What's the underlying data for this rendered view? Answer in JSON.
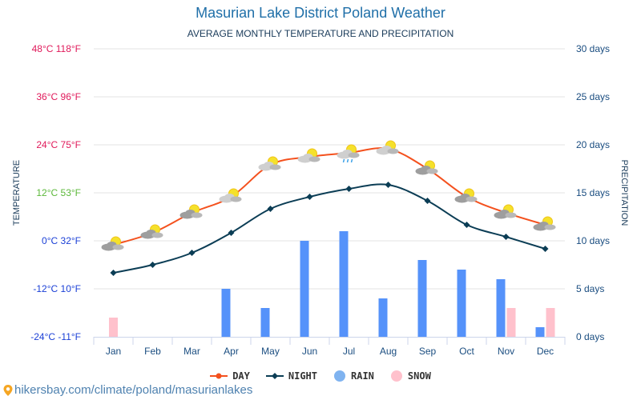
{
  "header": {
    "title": "Masurian Lake District Poland Weather",
    "subtitle": "AVERAGE MONTHLY TEMPERATURE AND PRECIPITATION"
  },
  "footer": {
    "icon": "location-pin-icon",
    "text": "hikersbay.com/climate/poland/masurianlakes"
  },
  "chart_data": {
    "type": "line+bar",
    "title": "Masurian Lake District Poland Weather",
    "subtitle": "AVERAGE MONTHLY TEMPERATURE AND PRECIPITATION",
    "categories": [
      "Jan",
      "Feb",
      "Mar",
      "Apr",
      "May",
      "Jun",
      "Jul",
      "Aug",
      "Sep",
      "Oct",
      "Nov",
      "Dec"
    ],
    "left_axis": {
      "label": "TEMPERATURE",
      "unit": "°C",
      "range": [
        -24,
        48
      ],
      "ticks": [
        {
          "value": -24,
          "label": "-24°C -11°F",
          "color": "#1a3fd6"
        },
        {
          "value": -12,
          "label": "-12°C 10°F",
          "color": "#1a3fd6"
        },
        {
          "value": 0,
          "label": "0°C 32°F",
          "color": "#1a3fd6"
        },
        {
          "value": 12,
          "label": "12°C 53°F",
          "color": "#5cb83a"
        },
        {
          "value": 24,
          "label": "24°C 75°F",
          "color": "#e0195a"
        },
        {
          "value": 36,
          "label": "36°C 96°F",
          "color": "#e0195a"
        },
        {
          "value": 48,
          "label": "48°C 118°F",
          "color": "#e0195a"
        }
      ]
    },
    "right_axis": {
      "label": "PRECIPITATION",
      "unit": "days",
      "range": [
        0,
        30
      ],
      "ticks": [
        {
          "value": 0,
          "label": "0 days"
        },
        {
          "value": 5,
          "label": "5 days"
        },
        {
          "value": 10,
          "label": "10 days"
        },
        {
          "value": 15,
          "label": "15 days"
        },
        {
          "value": 20,
          "label": "20 days"
        },
        {
          "value": 25,
          "label": "25 days"
        },
        {
          "value": 30,
          "label": "30 days"
        }
      ]
    },
    "grid": true,
    "legend_position": "bottom-center",
    "series": [
      {
        "name": "DAY",
        "type": "line",
        "axis": "left",
        "color": "#f4511e",
        "values": [
          -1,
          2,
          7,
          11,
          19,
          21,
          22,
          23,
          18,
          11,
          7,
          4
        ]
      },
      {
        "name": "NIGHT",
        "type": "line",
        "axis": "left",
        "color": "#0b3d55",
        "values": [
          -8,
          -6,
          -3,
          2,
          8,
          11,
          13,
          14,
          10,
          4,
          1,
          -2
        ]
      },
      {
        "name": "RAIN",
        "type": "bar",
        "axis": "right",
        "color": "#5592fa",
        "values": [
          0,
          0,
          0,
          5,
          3,
          10,
          11,
          4,
          8,
          7,
          6,
          1
        ]
      },
      {
        "name": "SNOW",
        "type": "bar",
        "axis": "right",
        "color": "#ffc1cc",
        "values": [
          2,
          0,
          0,
          0,
          0,
          0,
          0,
          0,
          0,
          0,
          3,
          3
        ]
      }
    ],
    "weather_icons": [
      "sun-cloud",
      "sun-cloud",
      "sun-cloud",
      "sun-cloud",
      "sun-cloud",
      "sun-cloud",
      "sun-rain-cloud",
      "sun-cloud",
      "sun-cloud",
      "sun-cloud",
      "sun-cloud",
      "sun-cloud"
    ]
  },
  "legend": [
    {
      "label": "DAY",
      "icon": "day-line-marker",
      "color": "#f4511e"
    },
    {
      "label": "NIGHT",
      "icon": "night-line-marker",
      "color": "#0b3d55"
    },
    {
      "label": "RAIN",
      "icon": "rain-dot",
      "color": "#7fb3f0"
    },
    {
      "label": "SNOW",
      "icon": "snow-dot",
      "color": "#ffc1cc"
    }
  ]
}
